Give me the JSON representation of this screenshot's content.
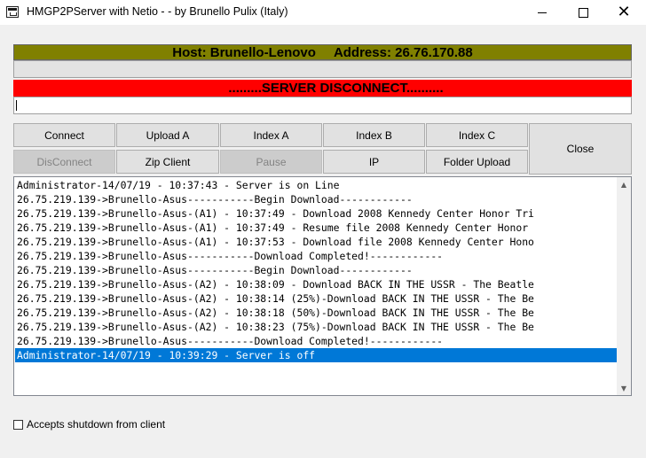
{
  "window": {
    "title": "HMGP2PServer with Netio - - by Brunello Pulix (Italy)",
    "min_icon": "minimize-icon",
    "max_icon": "maximize-icon",
    "close_icon": "close-icon"
  },
  "host": {
    "label": "Host: Brunello-Lenovo",
    "address": "Address: 26.76.170.88"
  },
  "status": {
    "text": ".........SERVER DISCONNECT..........",
    "color": "#ff0000",
    "input_value": ""
  },
  "buttons": {
    "connect": "Connect",
    "upload_a": "Upload A",
    "index_a": "Index A",
    "index_b": "Index B",
    "index_c": "Index C",
    "close": "Close",
    "disconnect": "DisConnect",
    "zip_client": "Zip Client",
    "pause": "Pause",
    "ip": "IP",
    "folder_upload": "Folder Upload"
  },
  "log": {
    "lines": [
      "Administrator-14/07/19 - 10:37:43 - Server is on Line",
      "26.75.219.139->Brunello-Asus-----------Begin Download------------",
      "26.75.219.139->Brunello-Asus-(A1) - 10:37:49 - Download 2008 Kennedy Center Honor Tri",
      "26.75.219.139->Brunello-Asus-(A1) - 10:37:49 - Resume file 2008 Kennedy Center Honor",
      "26.75.219.139->Brunello-Asus-(A1) - 10:37:53 - Download file 2008 Kennedy Center Hono",
      "26.75.219.139->Brunello-Asus-----------Download Completed!------------",
      "26.75.219.139->Brunello-Asus-----------Begin Download------------",
      "26.75.219.139->Brunello-Asus-(A2) - 10:38:09 - Download BACK IN THE USSR - The Beatle",
      "26.75.219.139->Brunello-Asus-(A2) - 10:38:14 (25%)-Download BACK IN THE USSR - The Be",
      "26.75.219.139->Brunello-Asus-(A2) - 10:38:18 (50%)-Download BACK IN THE USSR - The Be",
      "26.75.219.139->Brunello-Asus-(A2) - 10:38:23 (75%)-Download BACK IN THE USSR - The Be",
      "26.75.219.139->Brunello-Asus-----------Download Completed!------------",
      "Administrator-14/07/19 - 10:39:29 - Server is off"
    ],
    "selected_index": 12
  },
  "options": {
    "accept_shutdown_label": "Accepts shutdown from client",
    "accept_shutdown_checked": false
  },
  "colors": {
    "host_bar": "#808000",
    "status_bar": "#ff0000",
    "selection": "#0078d7"
  }
}
